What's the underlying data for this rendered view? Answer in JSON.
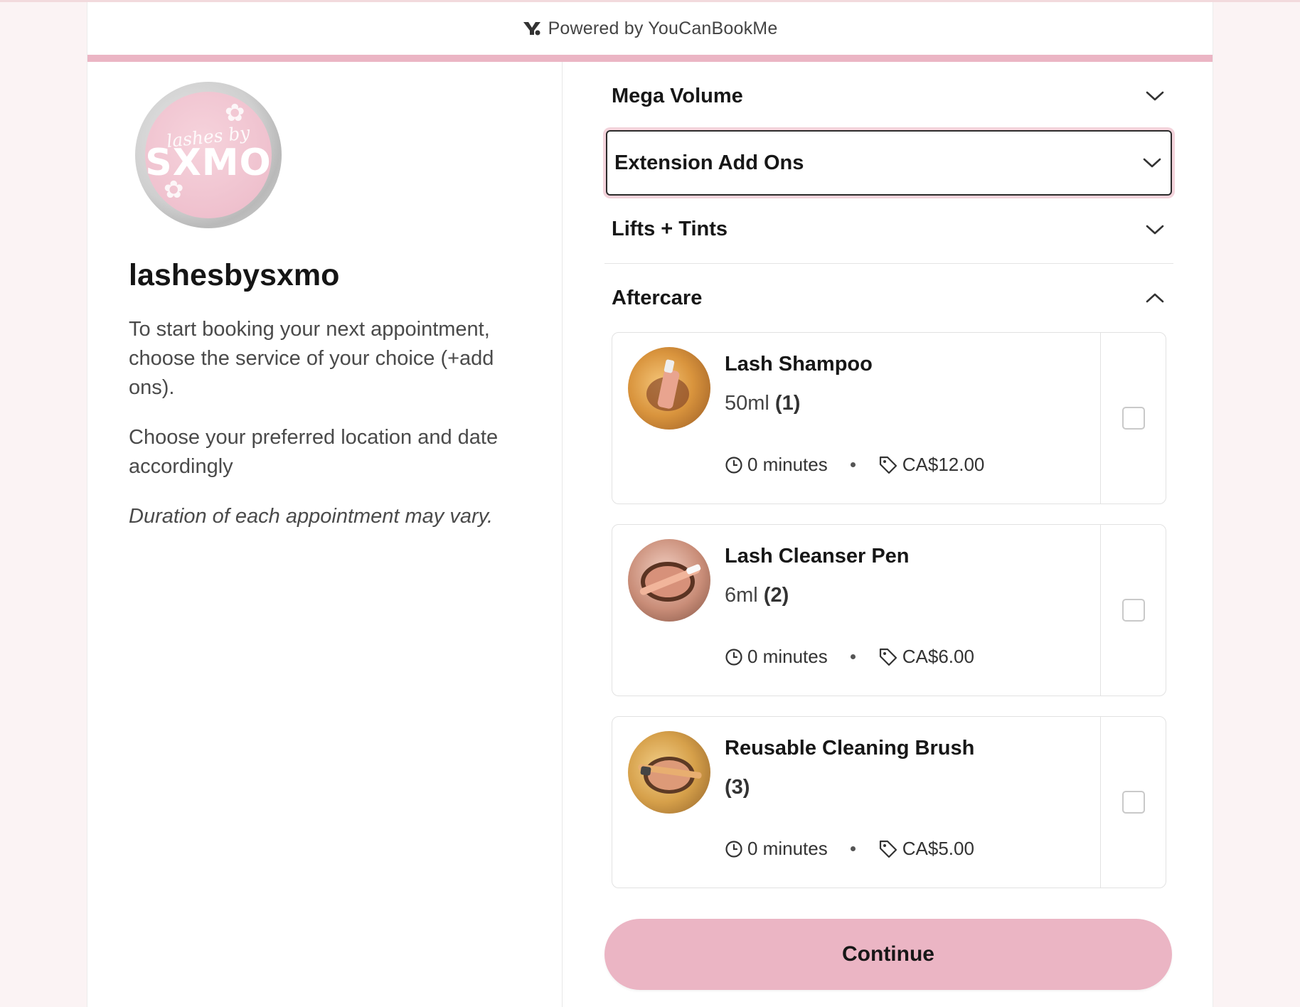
{
  "header": {
    "powered_by": "Powered by YouCanBookMe"
  },
  "business": {
    "logo_script": "lashes by",
    "logo_word": "SXMO",
    "name": "lashesbysxmo",
    "description": [
      "To start booking your next appointment, choose the service of your choice (+add ons).",
      "Choose your preferred location and date accordingly"
    ],
    "note": "Duration of each appointment may vary."
  },
  "accordion": [
    {
      "label": "Mega Volume",
      "expanded": false
    },
    {
      "label": "Extension Add Ons",
      "expanded": false,
      "focused": true
    },
    {
      "label": "Lifts + Tints",
      "expanded": false
    },
    {
      "label": "Aftercare",
      "expanded": true
    }
  ],
  "aftercare_items": [
    {
      "title": "Lash Shampoo",
      "subtitle": "50ml",
      "count": "(1)",
      "duration": "0 minutes",
      "price": "CA$12.00",
      "checked": false
    },
    {
      "title": "Lash Cleanser Pen",
      "subtitle": "6ml",
      "count": "(2)",
      "duration": "0 minutes",
      "price": "CA$6.00",
      "checked": false
    },
    {
      "title": "Reusable Cleaning Brush",
      "subtitle": "",
      "count": "(3)",
      "duration": "0 minutes",
      "price": "CA$5.00",
      "checked": false
    }
  ],
  "continue_label": "Continue",
  "colors": {
    "accent": "#ebb5c4",
    "page_bg": "#fbf3f4"
  }
}
